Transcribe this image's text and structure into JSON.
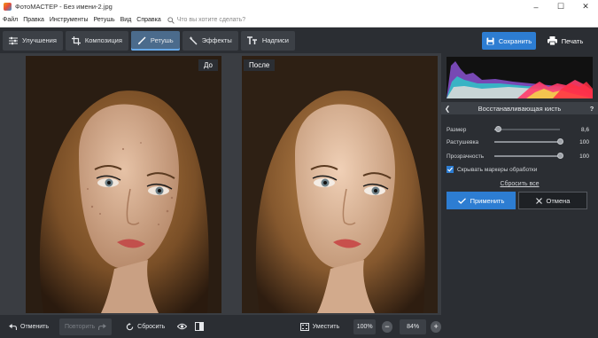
{
  "window": {
    "title": "ФотоМАСТЕР - Без имени-2.jpg",
    "controls": [
      "minimize",
      "maximize",
      "close"
    ]
  },
  "menu": {
    "items": [
      "Файл",
      "Правка",
      "Инструменты",
      "Ретушь",
      "Вид",
      "Справка"
    ],
    "search_placeholder": "Что вы хотите сделать?"
  },
  "toolbar": {
    "tabs": [
      {
        "label": "Улучшения",
        "icon": "sliders-icon",
        "active": false
      },
      {
        "label": "Композиция",
        "icon": "crop-icon",
        "active": false
      },
      {
        "label": "Ретушь",
        "icon": "brush-icon",
        "active": true
      },
      {
        "label": "Эффекты",
        "icon": "wand-icon",
        "active": false
      },
      {
        "label": "Надписи",
        "icon": "text-icon",
        "active": false
      }
    ],
    "save_label": "Сохранить",
    "print_label": "Печать"
  },
  "canvas": {
    "before_label": "До",
    "after_label": "После"
  },
  "bottom": {
    "undo_label": "Отменить",
    "redo_label": "Повторить",
    "reset_label": "Сбросить",
    "fit_label": "Уместить",
    "zoom_100": "100%",
    "zoom_level": "84%"
  },
  "panel": {
    "tool_title": "Восстанавливающая кисть",
    "sliders": [
      {
        "label": "Размер",
        "value": "8,6",
        "fraction": 0.05
      },
      {
        "label": "Растушевка",
        "value": "100",
        "fraction": 1.0
      },
      {
        "label": "Прозрачность",
        "value": "100",
        "fraction": 1.0
      }
    ],
    "checkbox_label": "Скрывать маркеры обработки",
    "checkbox_checked": true,
    "reset_all_label": "Сбросить все",
    "apply_label": "Применить",
    "cancel_label": "Отмена"
  },
  "colors": {
    "accent": "#2d7dd2",
    "panel_bg": "#2b2e33",
    "canvas_bg": "#3a3d42",
    "active_tab": "#4b6b8c"
  }
}
